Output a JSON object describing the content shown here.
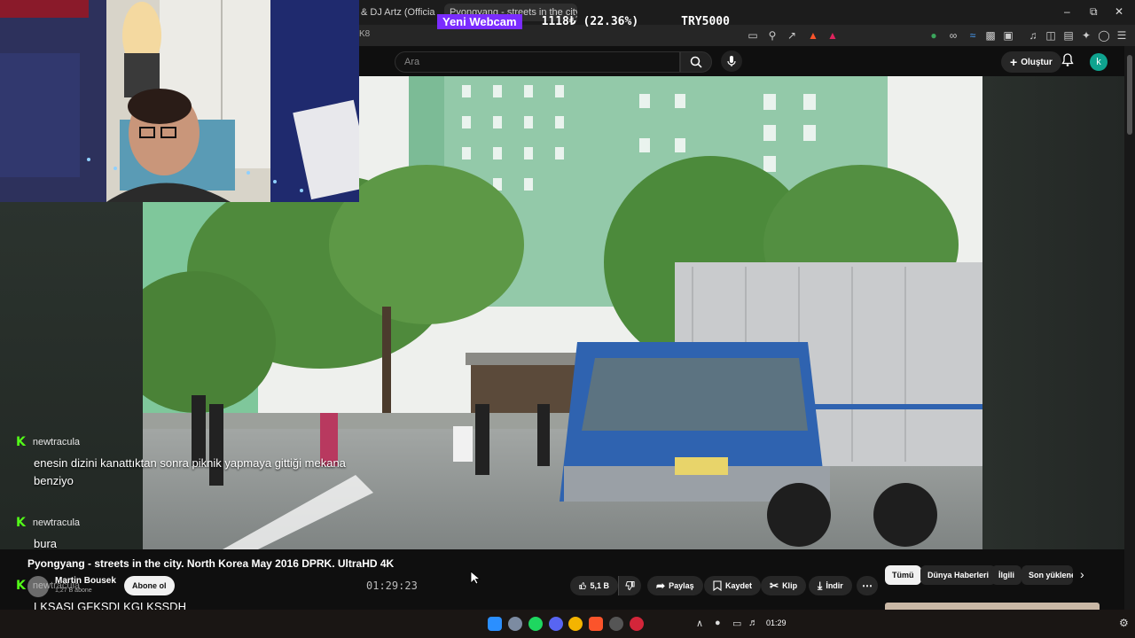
{
  "browser": {
    "tabs": [
      "& DJ Artz (Official Vid",
      "Pyongyang - streets in the city"
    ],
    "url_fragment": "K8"
  },
  "overlay": {
    "label": "Yeni Webcam",
    "stat": "1118₺ (22.36%)",
    "goal": "TRY5000"
  },
  "youtube": {
    "search_placeholder": "Ara",
    "create_label": "Oluştur",
    "avatar_letter": "k"
  },
  "chat": {
    "messages": [
      {
        "user": "newtracula",
        "text": "enesin dizini kanattıktan sonra piknik yapmaya gittiği mekana benziyo"
      },
      {
        "user": "newtracula",
        "text": "bura"
      },
      {
        "user": "newtracula",
        "text": "LKSAŞLGFKSDLKGLKŞSDH"
      }
    ]
  },
  "video": {
    "title": "Pyongyang - streets in the city. North Korea May 2016 DPRK. UltraHD 4K",
    "timestamp": "01:29:23",
    "channel_name": "Martin Bousek",
    "channel_subs": "1,27 B abone",
    "subscribe_label": "Abone ol",
    "like_count": "5,1 B",
    "actions": {
      "share": "Paylaş",
      "save": "Kaydet",
      "clip": "Klip",
      "download": "İndir"
    }
  },
  "chips": [
    "Tümü",
    "Dünya Haberleri",
    "İlgili",
    "Son yüklenen"
  ],
  "taskbar": {
    "time": "01:29"
  },
  "colors": {
    "overlay_purple": "#7b2cff",
    "kick_green": "#53fc18",
    "avatar_teal": "#0fa38f",
    "truck_blue": "#2f63b0"
  }
}
